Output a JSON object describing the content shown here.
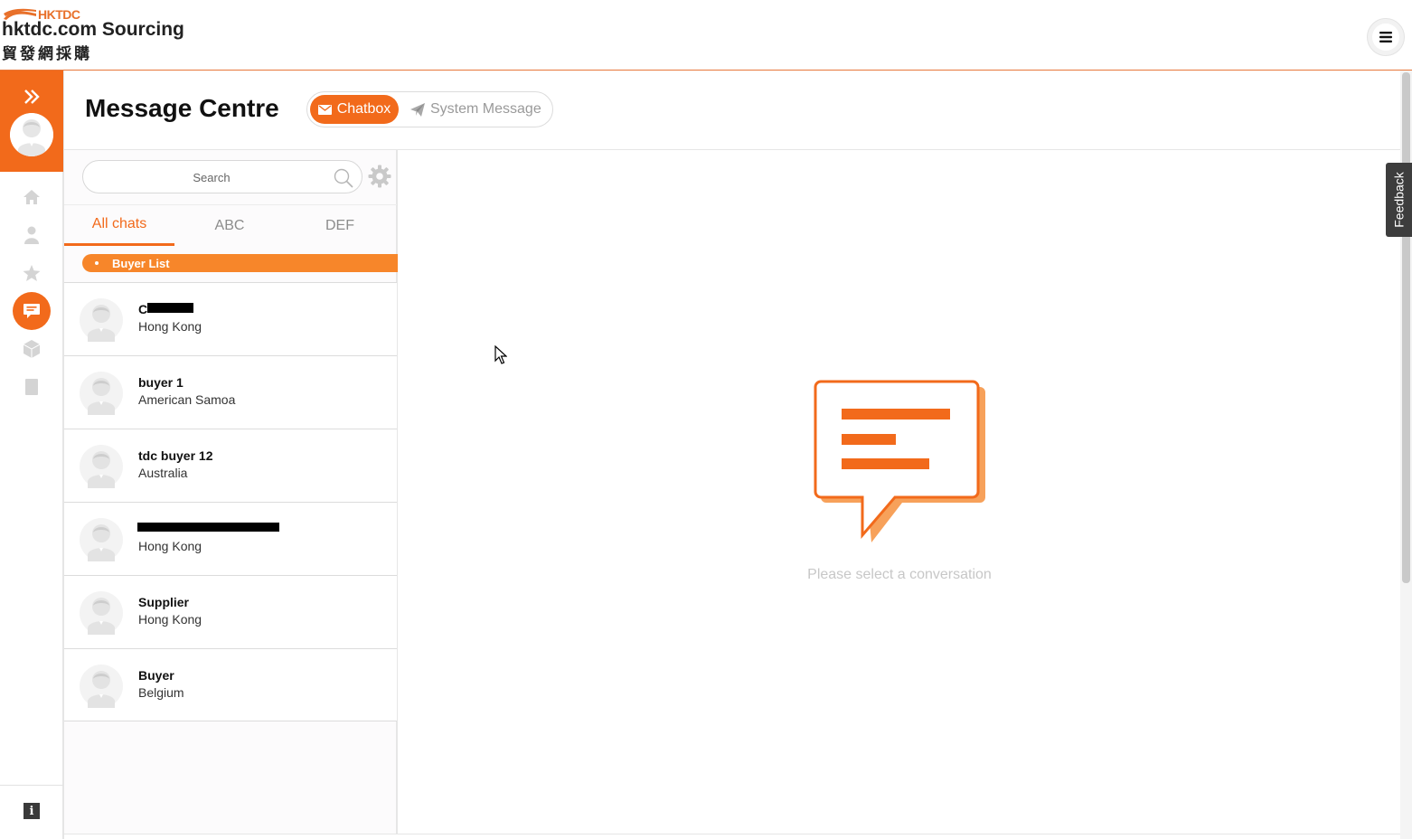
{
  "header": {
    "logo_mark_text": "HKTDC",
    "brand_en": "hktdc.com Sourcing",
    "brand_zh": "貿發網採購",
    "menu_icon": "hamburger-icon"
  },
  "rail": {
    "items": [
      {
        "icon": "home-icon"
      },
      {
        "icon": "user-icon"
      },
      {
        "icon": "star-icon"
      },
      {
        "icon": "chat-icon",
        "active": true
      },
      {
        "icon": "box-icon"
      },
      {
        "icon": "document-icon"
      }
    ],
    "info_label": "i"
  },
  "page": {
    "title": "Message Centre",
    "modes": {
      "chatbox_label": "Chatbox",
      "system_label": "System Message"
    }
  },
  "chatlist": {
    "search_placeholder": "Search",
    "tabs": [
      {
        "label": "All chats",
        "active": true
      },
      {
        "label": "ABC"
      },
      {
        "label": "DEF"
      }
    ],
    "group_label": "Buyer List",
    "conversations": [
      {
        "name": "C",
        "country": "Hong Kong"
      },
      {
        "name": "buyer 1",
        "country": "American Samoa"
      },
      {
        "name": "tdc buyer 12",
        "country": "Australia"
      },
      {
        "name": "",
        "country": "Hong Kong"
      },
      {
        "name": "Supplier",
        "country": "Hong Kong"
      },
      {
        "name": "Buyer",
        "country": "Belgium"
      }
    ]
  },
  "empty_state": {
    "message": "Please select a conversation"
  },
  "feedback": {
    "label": "Feedback"
  },
  "colors": {
    "brand_orange": "#f26a1b",
    "accent_orange": "#f7862a"
  }
}
